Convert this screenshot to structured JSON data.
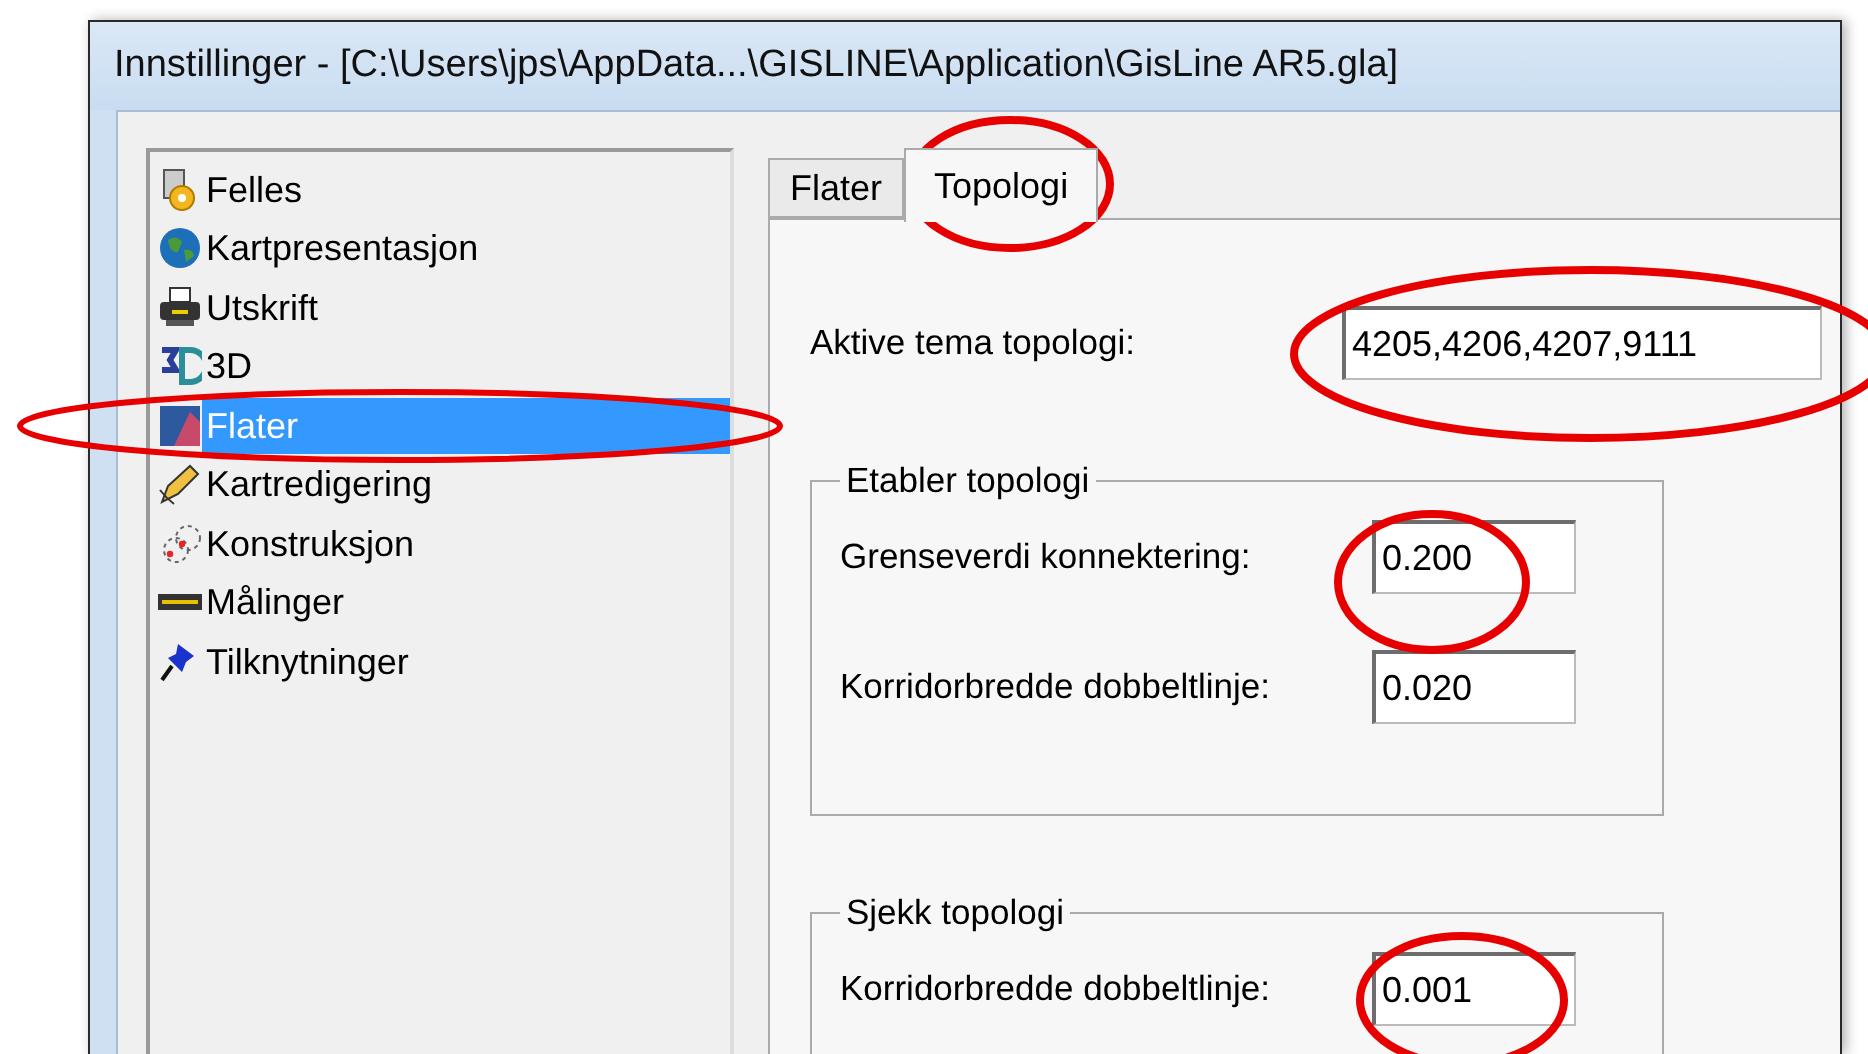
{
  "window": {
    "title": "Innstillinger - [C:\\Users\\jps\\AppData...\\GISLINE\\Application\\GisLine AR5.gla]"
  },
  "sidebar": {
    "items": [
      {
        "label": "Felles",
        "selected": false
      },
      {
        "label": "Kartpresentasjon",
        "selected": false
      },
      {
        "label": "Utskrift",
        "selected": false
      },
      {
        "label": "3D",
        "selected": false
      },
      {
        "label": "Flater",
        "selected": true
      },
      {
        "label": "Kartredigering",
        "selected": false
      },
      {
        "label": "Konstruksjon",
        "selected": false
      },
      {
        "label": "Målinger",
        "selected": false
      },
      {
        "label": "Tilknytninger",
        "selected": false
      }
    ]
  },
  "tabs": [
    {
      "label": "Flater",
      "selected": false
    },
    {
      "label": "Topologi",
      "selected": true
    }
  ],
  "active_themes": {
    "label": "Aktive tema topologi:",
    "value": "4205,4206,4207,9111"
  },
  "groups": [
    {
      "title": "Etabler topologi",
      "fields": [
        {
          "label": "Grenseverdi konnektering:",
          "value": "0.200"
        },
        {
          "label": "Korridorbredde dobbeltlinje:",
          "value": "0.020"
        }
      ]
    },
    {
      "title": "Sjekk topologi",
      "fields": [
        {
          "label": "Korridorbredde dobbeltlinje:",
          "value": "0.001"
        }
      ]
    }
  ]
}
